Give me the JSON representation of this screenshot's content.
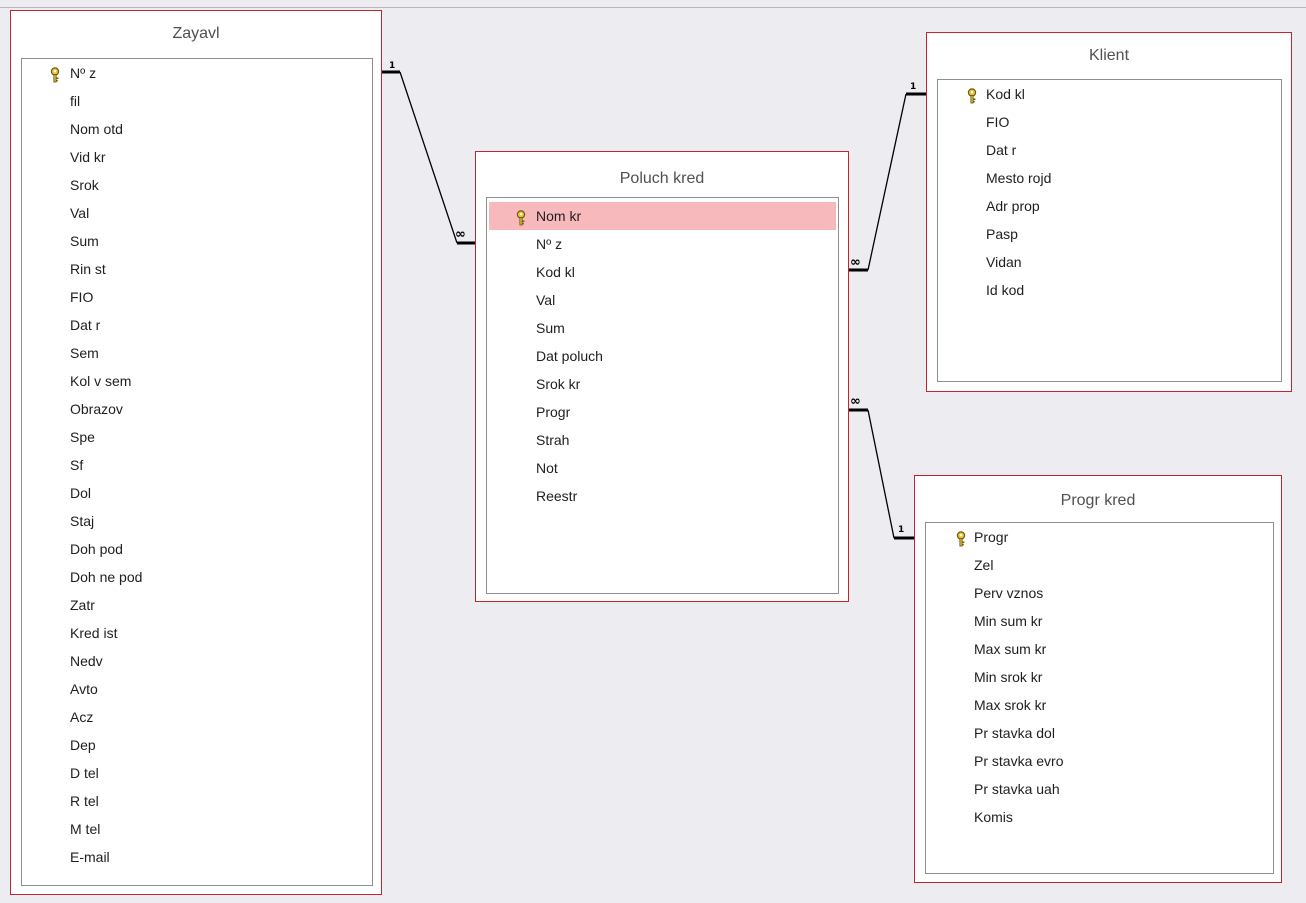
{
  "tables": {
    "zayavl": {
      "title": "Zayavl",
      "key_field": "Nº z",
      "fields": [
        "fil",
        "Nom otd",
        "Vid kr",
        "Srok",
        "Val",
        "Sum",
        "Rin st",
        "FIO",
        "Dat r",
        "Sem",
        "Kol v sem",
        "Obrazov",
        "Spe",
        "Sf",
        "Dol",
        "Staj",
        "Doh pod",
        "Doh ne pod",
        "Zatr",
        "Kred ist",
        "Nedv",
        "Avto",
        "Acz",
        "Dep",
        "D tel",
        "R tel",
        "M tel",
        "E-mail"
      ]
    },
    "poluch_kred": {
      "title": "Poluch kred",
      "key_field": "Nom kr",
      "fields": [
        "Nº z",
        "Kod kl",
        "Val",
        "Sum",
        "Dat poluch",
        "Srok kr",
        "Progr",
        "Strah",
        "Not",
        "Reestr"
      ]
    },
    "klient": {
      "title": "Klient",
      "key_field": "Kod kl",
      "fields": [
        "FIO",
        "Dat r",
        "Mesto rojd",
        "Adr prop",
        "Pasp",
        "Vidan",
        "Id kod"
      ]
    },
    "progr_kred": {
      "title": "Progr kred",
      "key_field": "Progr",
      "fields": [
        "Zel",
        "Perv vznos",
        "Min sum kr",
        "Max sum kr",
        "Min srok kr",
        "Max srok kr",
        "Pr stavka dol",
        "Pr stavka evro",
        "Pr stavka uah",
        "Komis"
      ]
    }
  },
  "relationships": [
    {
      "from": "Zayavl.Nº z",
      "to": "Poluch kred.Nº z",
      "one_label": "1",
      "many_label": "∞"
    },
    {
      "from": "Klient.Kod kl",
      "to": "Poluch kred.Kod kl",
      "one_label": "1",
      "many_label": "∞"
    },
    {
      "from": "Progr kred.Progr",
      "to": "Poluch kred.Progr",
      "one_label": "1",
      "many_label": "∞"
    }
  ],
  "colors": {
    "table_border": "#c4242b",
    "selected_row": "#f8b9bd",
    "canvas": "#edecf0"
  },
  "icons": {
    "primary_key": "key-icon"
  }
}
